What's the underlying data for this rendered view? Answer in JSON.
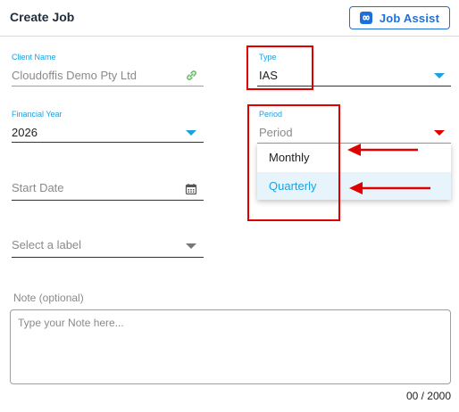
{
  "header": {
    "title": "Create Job",
    "job_assist_label": "Job Assist",
    "job_assist_icon": "infinity-icon"
  },
  "form": {
    "client_name": {
      "label": "Client Name",
      "value": "Cloudoffis Demo Pty Ltd",
      "icon": "link-icon"
    },
    "type": {
      "label": "Type",
      "value": "IAS"
    },
    "financial_year": {
      "label": "Financial Year",
      "value": "2026"
    },
    "period": {
      "label": "Period",
      "placeholder": "Period",
      "options": [
        "Monthly",
        "Quarterly"
      ],
      "highlighted": "Quarterly"
    },
    "start_date": {
      "placeholder": "Start Date",
      "icon": "calendar-icon"
    },
    "label_select": {
      "placeholder": "Select a label"
    },
    "note": {
      "label": "Note (optional)",
      "placeholder": "Type your Note here...",
      "counter": "00 / 2000"
    }
  },
  "colors": {
    "accent": "#1ba1e2",
    "brand_button": "#1e6fd9",
    "annotation_red": "#e00000",
    "highlight_bg": "#e8f4fb"
  }
}
